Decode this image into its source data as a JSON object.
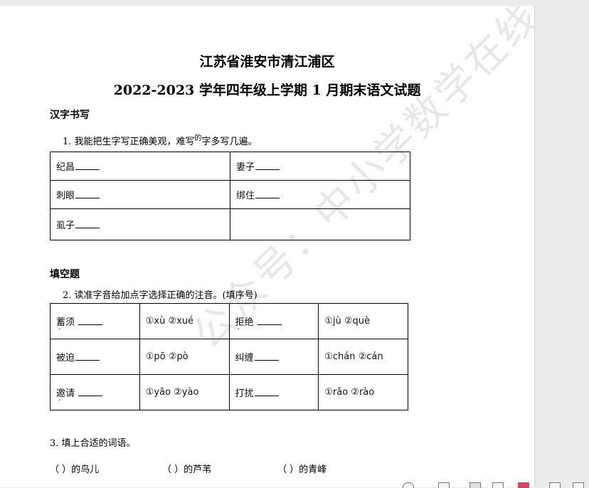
{
  "header": {
    "title_line1": "江苏省淮安市清江浦区",
    "title_line2": "2022-2023 学年四年级上学期 1 月期末语文试题"
  },
  "sections": {
    "s1": "汉字书写",
    "s2": "填空题"
  },
  "q1": {
    "prefix": "1.  我能把生字写正确美观，难写",
    "small": "的",
    "suffix": "字多写几遍。",
    "cells": [
      "纪昌",
      "妻子",
      "刺眼",
      "绑住",
      "虱子",
      ""
    ]
  },
  "q2": {
    "text": "2.  读准字音给加点字选择正确的注音。(填序号)",
    "rows": [
      {
        "w1": "蓄须",
        "o1": "①xù ②xué",
        "w2": "拒绝",
        "o2": "①jù ②què"
      },
      {
        "w1": "被迫",
        "o1": "①pō ②pò",
        "w2": "纠缠",
        "o2": "①chán ②cán"
      },
      {
        "w1": "邀请",
        "o1": "①yāo ②yào",
        "w2": "打扰",
        "o2": "①rǎo ②rào"
      }
    ]
  },
  "q3": {
    "text": "3.  填上合适的词语。",
    "items": [
      "（              ）的鸟儿",
      "（              ）的芦苇",
      "（              ）的青峰"
    ]
  },
  "watermark": "公众号：中小学数学在线"
}
